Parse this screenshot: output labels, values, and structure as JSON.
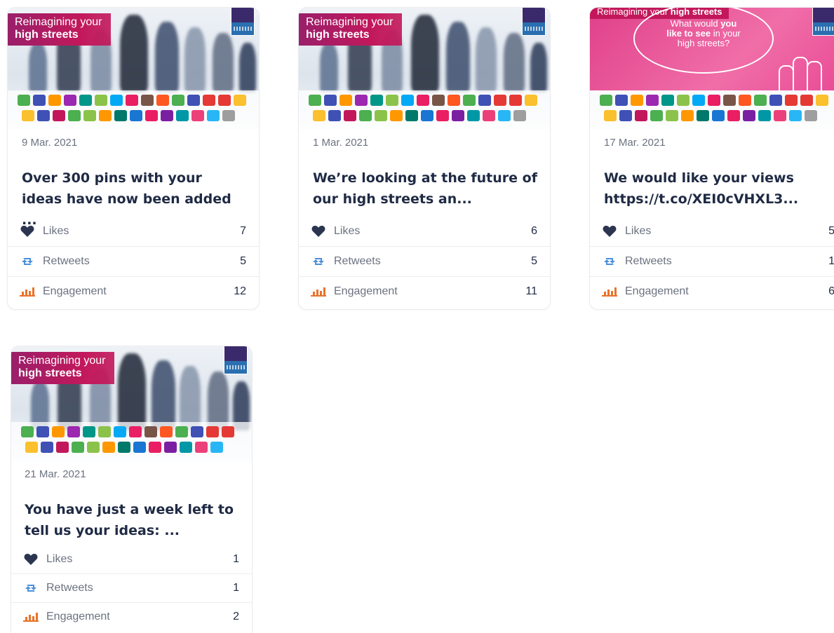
{
  "cards": [
    {
      "date": "9 Mar. 2021",
      "title": "Over 300 pins with your ideas have now been added ...",
      "image": {
        "type": "street",
        "banner_line1": "Reimagining your",
        "banner_line2": "high streets"
      },
      "stats": {
        "likes_label": "Likes",
        "likes": "7",
        "retweets_label": "Retweets",
        "retweets": "5",
        "engagement_label": "Engagement",
        "engagement": "12"
      }
    },
    {
      "date": "1 Mar. 2021",
      "title": "We’re looking at the future of our high streets an...",
      "image": {
        "type": "street",
        "banner_line1": "Reimagining your",
        "banner_line2": "high streets"
      },
      "stats": {
        "likes_label": "Likes",
        "likes": "6",
        "retweets_label": "Retweets",
        "retweets": "5",
        "engagement_label": "Engagement",
        "engagement": "11"
      }
    },
    {
      "date": "17 Mar. 2021",
      "title": "We would like your views https://t.co/XEI0cVHXL3...",
      "image": {
        "type": "pink",
        "banner_prefix": "Reimagining your",
        "banner_bold": "high streets",
        "bubble_line1": "What would",
        "bubble_bold1": "you",
        "bubble_bold2": "like to see",
        "bubble_line2": "in your",
        "bubble_line3": "high streets?"
      },
      "stats": {
        "likes_label": "Likes",
        "likes": "5",
        "retweets_label": "Retweets",
        "retweets": "1",
        "engagement_label": "Engagement",
        "engagement": "6"
      }
    },
    {
      "date": "21 Mar. 2021",
      "title": "You have just a week left to tell us your ideas: ...",
      "image": {
        "type": "street",
        "banner_line1": "Reimagining your",
        "banner_line2": "high streets"
      },
      "stats": {
        "likes_label": "Likes",
        "likes": "1",
        "retweets_label": "Retweets",
        "retweets": "1",
        "engagement_label": "Engagement",
        "engagement": "2"
      }
    }
  ],
  "colors": {
    "heart": "#2b3550",
    "retweet": "#4a90d9",
    "engagement": "#e8732a",
    "banner": "#c2185b"
  }
}
